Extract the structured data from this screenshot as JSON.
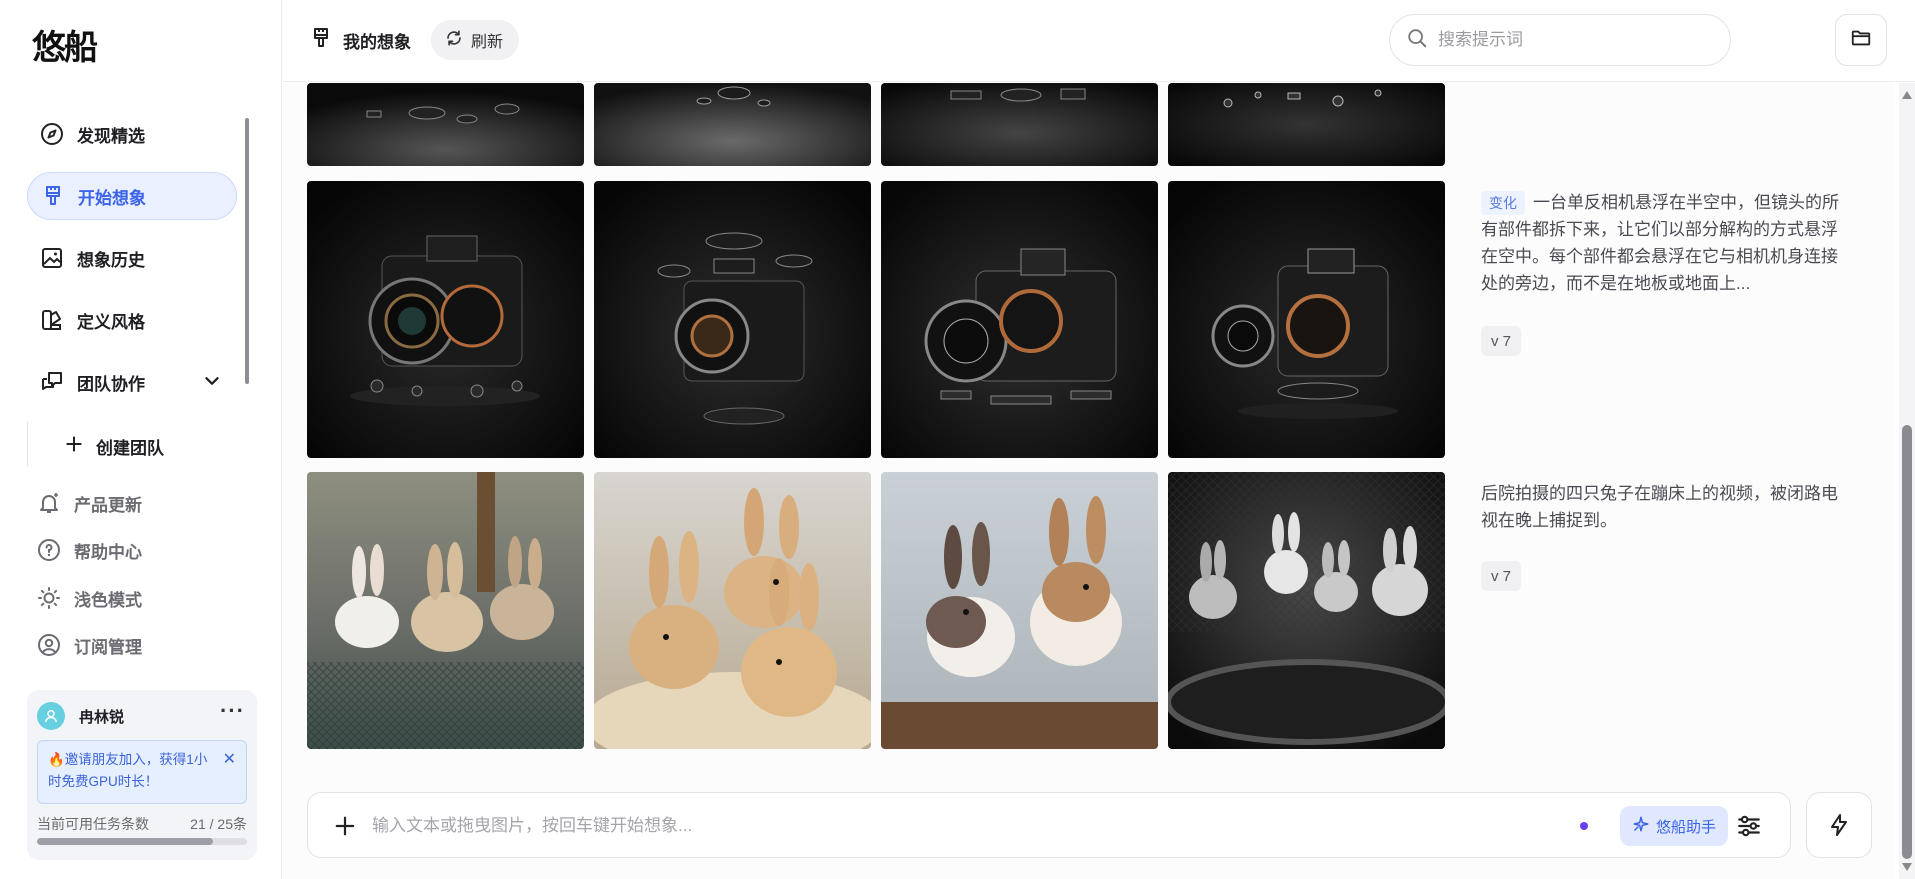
{
  "app": {
    "logo_text": "悠船"
  },
  "sidebar": {
    "nav": [
      {
        "label": "发现精选",
        "icon": "compass-icon"
      },
      {
        "label": "开始想象",
        "icon": "brush-icon",
        "active": true
      },
      {
        "label": "想象历史",
        "icon": "image-icon"
      },
      {
        "label": "定义风格",
        "icon": "style-icon"
      },
      {
        "label": "团队协作",
        "icon": "team-icon",
        "expandable": true
      }
    ],
    "sub_item": {
      "label": "创建团队",
      "icon": "plus-icon"
    },
    "utilities": [
      {
        "label": "产品更新",
        "icon": "bell-icon"
      },
      {
        "label": "帮助中心",
        "icon": "help-icon"
      },
      {
        "label": "浅色模式",
        "icon": "sun-icon"
      },
      {
        "label": "订阅管理",
        "icon": "user-circle-icon"
      }
    ],
    "user": {
      "name": "冉林锐",
      "more": "···",
      "invite_text": "🔥邀请朋友加入，获得1小时免费GPU时长！",
      "quota_label": "当前可用任务条数",
      "quota_count": "21 / 25条",
      "quota_fraction": 0.84
    }
  },
  "header": {
    "title": "我的想象",
    "refresh_label": "刷新",
    "search_placeholder": "搜索提示词"
  },
  "feed": {
    "rows": [
      {
        "tag": "变化",
        "prompt": "一台单反相机悬浮在半空中，但镜头的所有部件都拆下来，让它们以部分解构的方式悬浮在空中。每个部件都会悬浮在它与相机机身连接处的旁边，而不是在地板或地面上...",
        "version": "v 7"
      },
      {
        "tag": "",
        "prompt": "后院拍摄的四只兔子在蹦床上的视频，被闭路电视在晚上捕捉到。",
        "version": "v 7"
      }
    ]
  },
  "prompt_bar": {
    "placeholder": "输入文本或拖曳图片，按回车键开始想象...",
    "assistant_label": "悠船助手"
  },
  "colors": {
    "accent": "#3c64e8",
    "active_bg": "#eaf0ff",
    "purple_dot": "#6d3cf5"
  }
}
